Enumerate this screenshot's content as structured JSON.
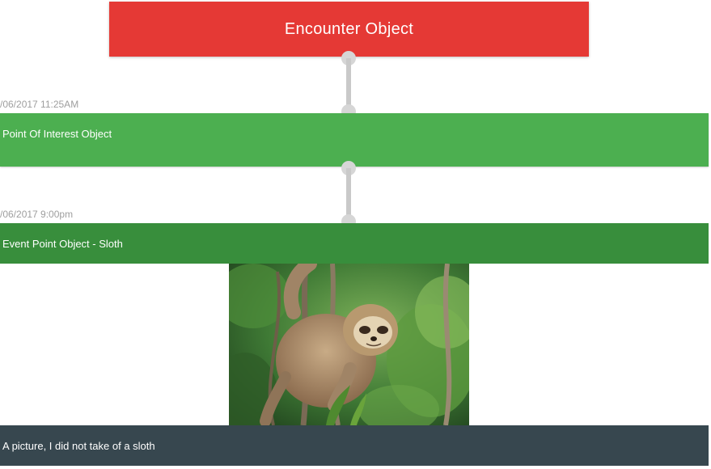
{
  "header": {
    "title": "Encounter Object"
  },
  "timeline": {
    "items": [
      {
        "timestamp": "/06/2017 11:25AM",
        "title": "Point Of Interest Object",
        "color": "#4caf50"
      },
      {
        "timestamp": "/06/2017 9:00pm",
        "title": "Event Point Object - Sloth",
        "color": "#388e3c",
        "image": "sloth-photo",
        "caption": "A picture, I did not take of a sloth",
        "caption_color": "#37474f"
      }
    ]
  },
  "colors": {
    "header": "#e53935",
    "connector": "#c9c9c9"
  }
}
